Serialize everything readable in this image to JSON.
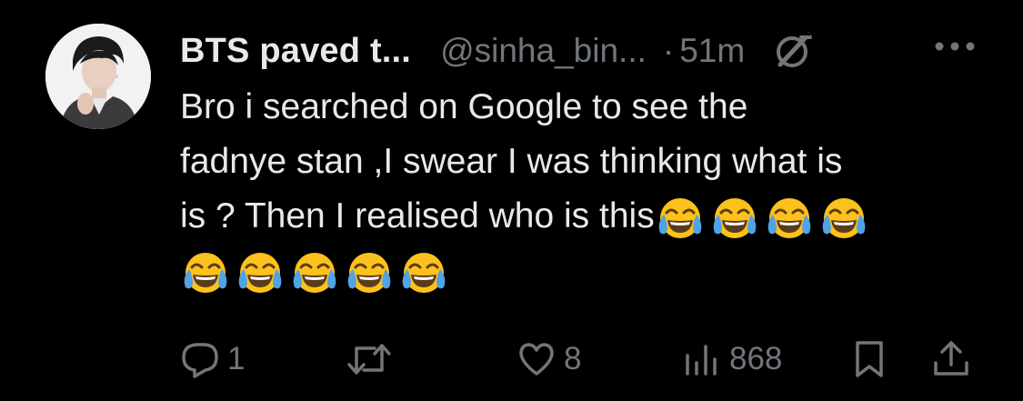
{
  "tweet": {
    "display_name": "BTS paved t...",
    "handle": "@sinha_bin...",
    "separator": "·",
    "time": "51m",
    "body_lines": [
      "Bro i searched on Google to see the",
      "fadnye stan ,I swear I was thinking what is",
      "is ? Then I realised who is this"
    ],
    "emoji": "😂",
    "emoji_count_line3": 4,
    "emoji_count_line4": 5
  },
  "actions": {
    "reply_count": "1",
    "retweet_count": "",
    "like_count": "8",
    "views_count": "868"
  },
  "icons": {
    "grok": "grok-icon",
    "more": "more-icon",
    "reply": "reply-icon",
    "retweet": "retweet-icon",
    "like": "heart-icon",
    "views": "views-icon",
    "bookmark": "bookmark-icon",
    "share": "share-icon"
  },
  "colors": {
    "background": "#000000",
    "text_primary": "#e7e9ea",
    "text_secondary": "#71767b"
  }
}
